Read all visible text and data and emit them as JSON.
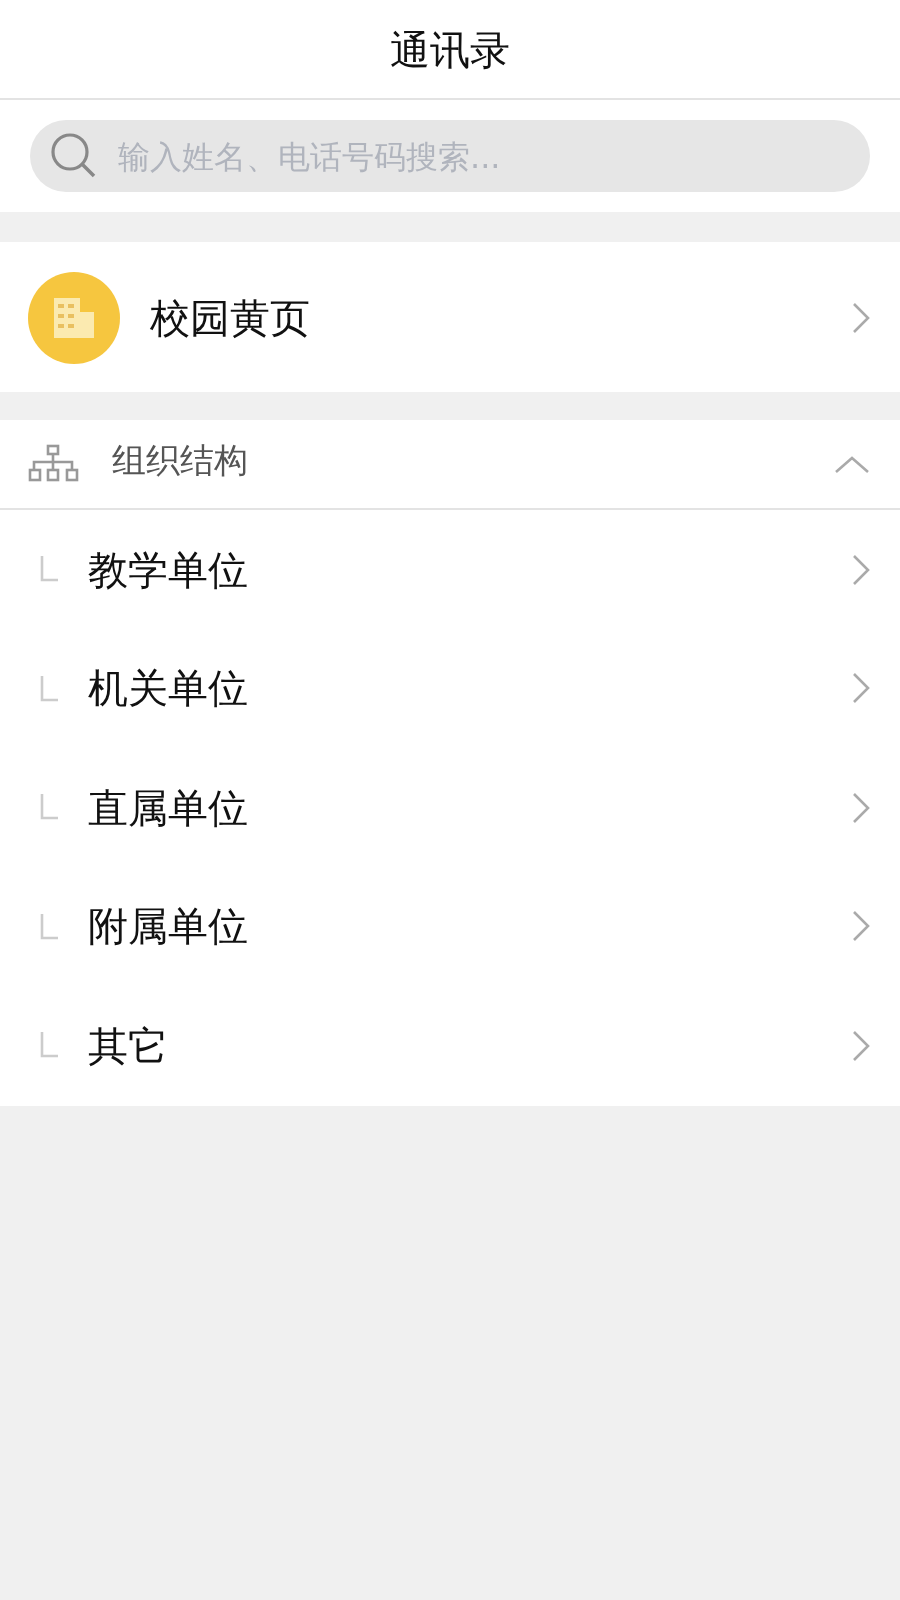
{
  "header": {
    "title": "通讯录"
  },
  "search": {
    "placeholder": "输入姓名、电话号码搜索..."
  },
  "yellow_pages": {
    "label": "校园黄页"
  },
  "org": {
    "title": "组织结构",
    "expanded": true,
    "children": [
      {
        "label": "教学单位"
      },
      {
        "label": "机关单位"
      },
      {
        "label": "直属单位"
      },
      {
        "label": "附属单位"
      },
      {
        "label": "其它"
      }
    ]
  }
}
